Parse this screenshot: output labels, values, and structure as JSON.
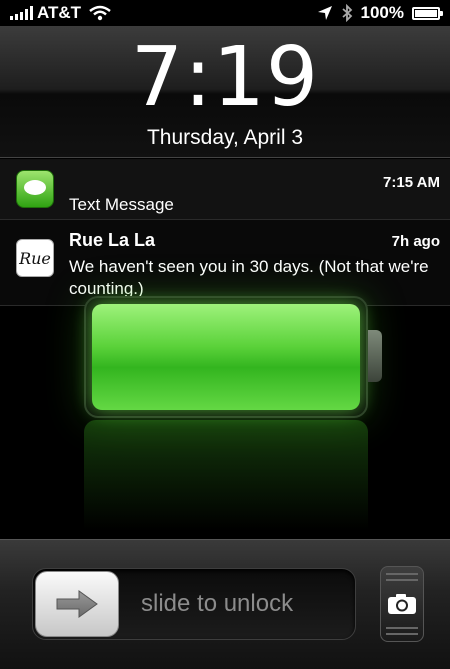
{
  "status_bar": {
    "carrier": "AT&T",
    "battery_percent": "100%",
    "icons": [
      "signal-icon",
      "wifi-icon",
      "location-icon",
      "bluetooth-icon",
      "battery-icon"
    ]
  },
  "lock": {
    "time": "7:19",
    "date": "Thursday, April 3"
  },
  "notifications": [
    {
      "app_icon": "messages-icon",
      "title": "",
      "time": "7:15 AM",
      "body": "Text Message"
    },
    {
      "app_icon": "rue-la-la-icon",
      "title": "Rue La La",
      "time": "7h ago",
      "body": "We haven't seen you in 30 days. (Not that we're counting.)"
    }
  ],
  "charging": {
    "level_fraction": 1.0,
    "fill_color": "#5bd23a"
  },
  "bottom": {
    "slide_label": "slide to unlock",
    "camera_icon": "camera-icon",
    "knob_icon": "arrow-right-icon"
  },
  "rue_icon_text": "Rue"
}
